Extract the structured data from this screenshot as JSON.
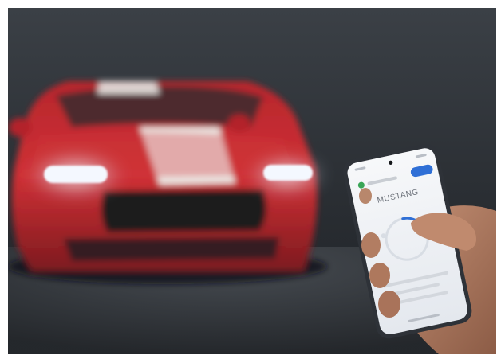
{
  "scene": {
    "subject": "red-sports-car",
    "accent_color": "#c7262b",
    "stripe_color": "#e9e6e2",
    "headlight_color": "#f4f8ff",
    "background_color": "#2c3035",
    "floor_color": "#3d4247"
  },
  "phone": {
    "app_title": "MUSTANG",
    "app_subtitle": "",
    "chip_label": "",
    "screen_color": "#f2f4f7",
    "control_color": "#2f6fd6"
  }
}
